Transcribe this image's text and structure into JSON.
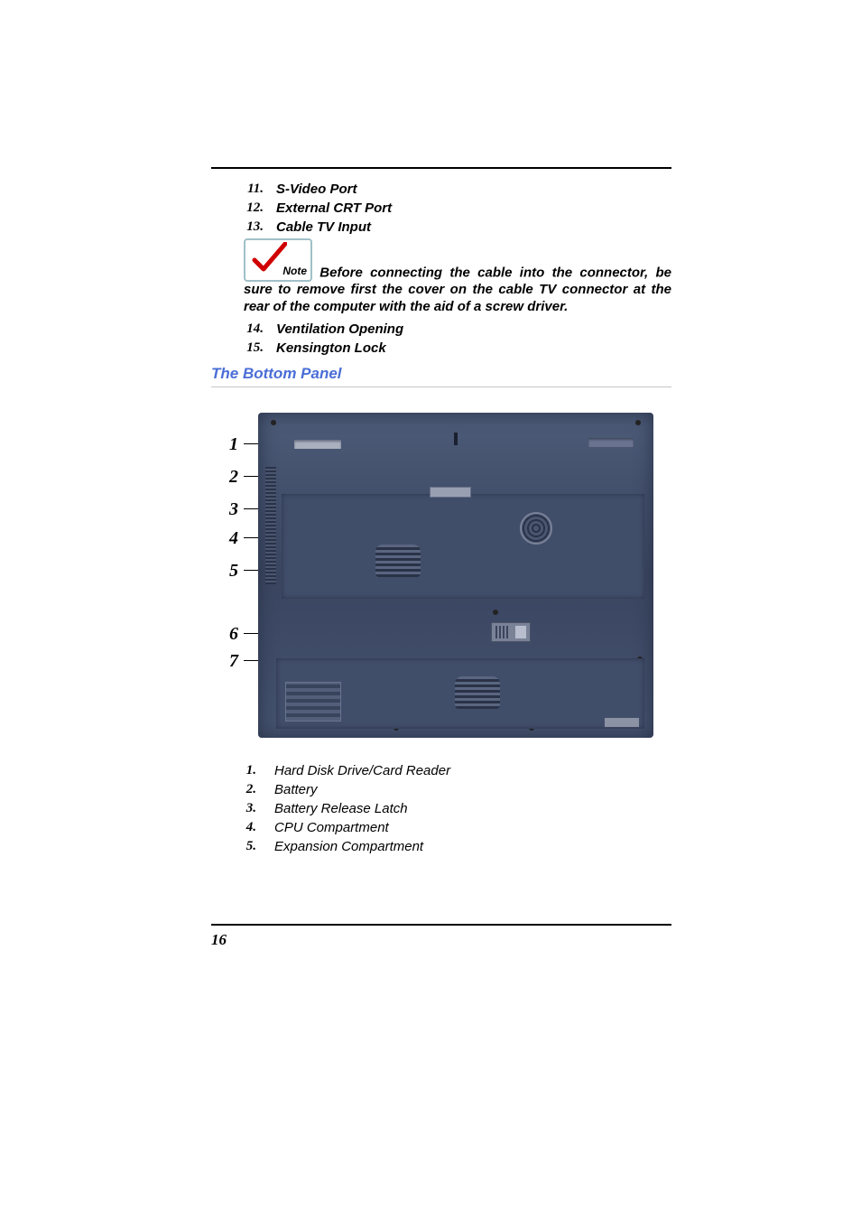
{
  "top_list": [
    {
      "num": "11.",
      "label": "S-Video Port"
    },
    {
      "num": "12.",
      "label": "External CRT Port"
    },
    {
      "num": "13.",
      "label": "Cable TV Input"
    }
  ],
  "note": {
    "icon_label": "Note",
    "text": "Before connecting the cable into the connector, be sure to remove first the cover on the cable TV connector at the rear of the computer with the aid of a screw driver."
  },
  "top_list_2": [
    {
      "num": "14.",
      "label": "Ventilation Opening"
    },
    {
      "num": "15.",
      "label": "Kensington Lock"
    }
  ],
  "section_title": "The Bottom Panel",
  "diagram_labels": [
    "1",
    "2",
    "3",
    "4",
    "5",
    "6",
    "7"
  ],
  "bottom_list": [
    {
      "num": "1.",
      "label": "Hard Disk Drive/Card Reader"
    },
    {
      "num": "2.",
      "label": "Battery"
    },
    {
      "num": "3.",
      "label": "Battery Release Latch"
    },
    {
      "num": "4.",
      "label": "CPU Compartment"
    },
    {
      "num": "5.",
      "label": "Expansion Compartment"
    }
  ],
  "page_number": "16"
}
